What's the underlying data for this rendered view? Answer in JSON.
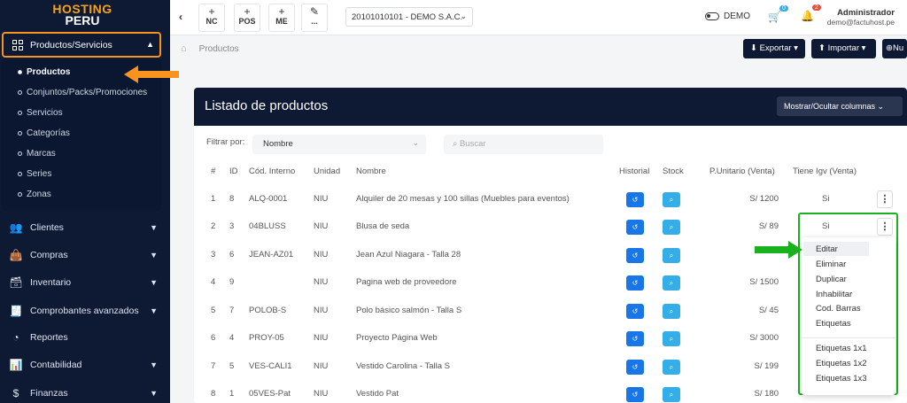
{
  "brand": {
    "line1": "HOSTING",
    "line2": "PERU"
  },
  "sidebar": {
    "active_label": "Productos/Servicios",
    "sub_items": [
      {
        "label": "Productos",
        "active": true
      },
      {
        "label": "Conjuntos/Packs/Promociones"
      },
      {
        "label": "Servicios"
      },
      {
        "label": "Categorías"
      },
      {
        "label": "Marcas"
      },
      {
        "label": "Series"
      },
      {
        "label": "Zonas"
      }
    ],
    "nav_items": [
      {
        "label": "Clientes",
        "icon": "users-icon"
      },
      {
        "label": "Compras",
        "icon": "shopping-bag-icon"
      },
      {
        "label": "Inventario",
        "icon": "archive-icon"
      },
      {
        "label": "Comprobantes avanzados",
        "icon": "receipt-icon"
      },
      {
        "label": "Reportes",
        "icon": "pie-chart-icon"
      },
      {
        "label": "Contabilidad",
        "icon": "bar-chart-icon"
      },
      {
        "label": "Finanzas",
        "icon": "dollar-icon"
      }
    ]
  },
  "topbar": {
    "quick_buttons": [
      "NC",
      "POS",
      "ME",
      "..."
    ],
    "company": "20101010101 - DEMO S.A.C.",
    "demo_label": "DEMO",
    "cart_count": "0",
    "notif_count": "2",
    "user_name": "Administrador",
    "user_email": "demo@factuhost.pe"
  },
  "breadcrumb": {
    "label": "Productos"
  },
  "actions": {
    "export": "Exportar",
    "import": "Importar",
    "new": "Nu"
  },
  "card": {
    "title": "Listado de productos",
    "toggle_columns": "Mostrar/Ocultar columnas"
  },
  "filter": {
    "label": "Filtrar por:",
    "value": "Nombre",
    "search_placeholder": "Buscar"
  },
  "table": {
    "headers": [
      "#",
      "ID",
      "Cód. Interno",
      "Unidad",
      "Nombre",
      "Historial",
      "Stock",
      "P.Unitario (Venta)",
      "Tiene Igv (Venta)"
    ],
    "rows": [
      {
        "n": "1",
        "id": "8",
        "code": "ALQ-0001",
        "unit": "NIU",
        "name": "Alquiler de 20 mesas y 100 sillas (Muebles para eventos)",
        "price": "S/ 1200",
        "igv": "Si"
      },
      {
        "n": "2",
        "id": "3",
        "code": "04BLUSS",
        "unit": "NIU",
        "name": "Blusa de seda",
        "price": "S/ 89",
        "igv": "Si"
      },
      {
        "n": "3",
        "id": "6",
        "code": "JEAN-AZ01",
        "unit": "NIU",
        "name": "Jean Azul Niagara - Talla 28",
        "price": "",
        "igv": ""
      },
      {
        "n": "4",
        "id": "9",
        "code": "",
        "unit": "NIU",
        "name": "Pagina web de proveedore",
        "price": "S/ 1500",
        "igv": ""
      },
      {
        "n": "5",
        "id": "7",
        "code": "POLOB-S",
        "unit": "NIU",
        "name": "Polo básico salmón - Talla S",
        "price": "S/ 45",
        "igv": ""
      },
      {
        "n": "6",
        "id": "4",
        "code": "PROY-05",
        "unit": "NIU",
        "name": "Proyecto Página Web",
        "price": "S/ 3000",
        "igv": ""
      },
      {
        "n": "7",
        "id": "5",
        "code": "VES-CALI1",
        "unit": "NIU",
        "name": "Vestido Carolina - Talla S",
        "price": "S/ 199",
        "igv": ""
      },
      {
        "n": "8",
        "id": "1",
        "code": "05VES-Pat",
        "unit": "NIU",
        "name": "Vestido Pat",
        "price": "S/ 180",
        "igv": ""
      }
    ]
  },
  "dropdown": [
    "Editar",
    "Eliminar",
    "Duplicar",
    "Inhabilitar",
    "Cod. Barras",
    "Etiquetas",
    "Etiquetas 1x1",
    "Etiquetas 1x2",
    "Etiquetas 1x3"
  ],
  "colors": {
    "sidebar": "#0e1a33",
    "accent_orange": "#f7931e",
    "accent_green": "#19b11d",
    "history_btn": "#1976e6",
    "stock_btn": "#33aee8"
  }
}
